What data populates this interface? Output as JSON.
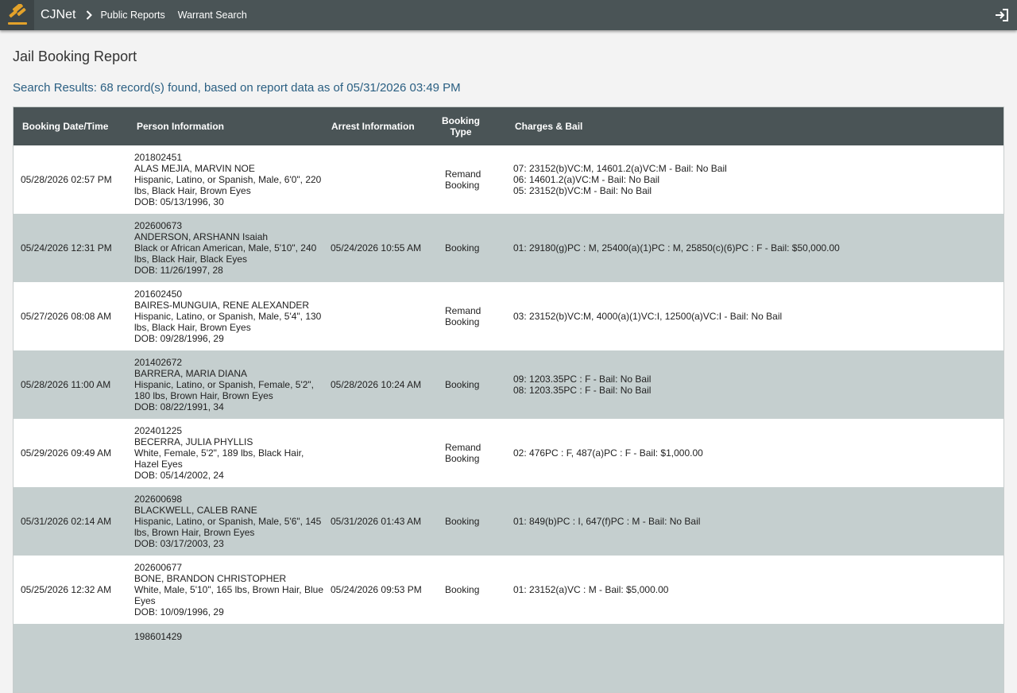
{
  "header": {
    "brand": "CJNet",
    "nav": [
      "Public Reports",
      "Warrant Search"
    ]
  },
  "page": {
    "title": "Jail Booking Report",
    "results": "Search Results: 68 record(s) found, based on report data as of 05/31/2026 03:49 PM"
  },
  "table": {
    "columns": [
      "Booking Date/Time",
      "Person Information",
      "Arrest Information",
      "Booking Type",
      "Charges & Bail"
    ],
    "rows": [
      {
        "booking": "05/28/2026 02:57 PM",
        "person": [
          "201802451",
          "ALAS MEJIA, MARVIN NOE",
          "Hispanic, Latino, or Spanish, Male, 6'0\", 220 lbs, Black Hair, Brown Eyes",
          "DOB: 05/13/1996, 30"
        ],
        "arrest": "",
        "type": [
          "Remand",
          "Booking"
        ],
        "charges": [
          "07: 23152(b)VC:M, 14601.2(a)VC:M - Bail: No Bail",
          "06: 14601.2(a)VC:M - Bail: No Bail",
          "05: 23152(b)VC:M - Bail: No Bail"
        ]
      },
      {
        "booking": "05/24/2026 12:31 PM",
        "person": [
          "202600673",
          "ANDERSON, ARSHANN Isaiah",
          "Black or African American, Male, 5'10\", 240 lbs, Black Hair, Black Eyes",
          "DOB: 11/26/1997, 28"
        ],
        "arrest": "05/24/2026 10:55 AM",
        "type": [
          "Booking"
        ],
        "charges": [
          "01: 29180(g)PC : M, 25400(a)(1)PC : M, 25850(c)(6)PC : F - Bail: $50,000.00"
        ]
      },
      {
        "booking": "05/27/2026 08:08 AM",
        "person": [
          "201602450",
          "BAIRES-MUNGUIA, RENE ALEXANDER",
          "Hispanic, Latino, or Spanish, Male, 5'4\", 130 lbs, Black Hair, Brown Eyes",
          "DOB: 09/28/1996, 29"
        ],
        "arrest": "",
        "type": [
          "Remand",
          "Booking"
        ],
        "charges": [
          "03: 23152(b)VC:M, 4000(a)(1)VC:I, 12500(a)VC:I - Bail: No Bail"
        ]
      },
      {
        "booking": "05/28/2026 11:00 AM",
        "person": [
          "201402672",
          "BARRERA, MARIA DIANA",
          "Hispanic, Latino, or Spanish, Female, 5'2\", 180 lbs, Brown Hair, Brown Eyes",
          "DOB: 08/22/1991, 34"
        ],
        "arrest": "05/28/2026 10:24 AM",
        "type": [
          "Booking"
        ],
        "charges": [
          "09: 1203.35PC : F - Bail: No Bail",
          "08: 1203.35PC : F - Bail: No Bail"
        ]
      },
      {
        "booking": "05/29/2026 09:49 AM",
        "person": [
          "202401225",
          "BECERRA, JULIA PHYLLIS",
          "White, Female, 5'2\", 189 lbs, Black Hair, Hazel Eyes",
          "DOB: 05/14/2002, 24"
        ],
        "arrest": "",
        "type": [
          "Remand",
          "Booking"
        ],
        "charges": [
          "02: 476PC : F, 487(a)PC : F - Bail: $1,000.00"
        ]
      },
      {
        "booking": "05/31/2026 02:14 AM",
        "person": [
          "202600698",
          "BLACKWELL, CALEB RANE",
          "Hispanic, Latino, or Spanish, Male, 5'6\", 145 lbs, Brown Hair, Brown Eyes",
          "DOB: 03/17/2003, 23"
        ],
        "arrest": "05/31/2026 01:43 AM",
        "type": [
          "Booking"
        ],
        "charges": [
          "01: 849(b)PC : I, 647(f)PC : M - Bail: No Bail"
        ]
      },
      {
        "booking": "05/25/2026 12:32 AM",
        "person": [
          "202600677",
          "BONE, BRANDON CHRISTOPHER",
          "White, Male, 5'10\", 165 lbs, Brown Hair, Blue Eyes",
          "DOB: 10/09/1996, 29"
        ],
        "arrest": "05/24/2026 09:53 PM",
        "type": [
          "Booking"
        ],
        "charges": [
          "01: 23152(a)VC : M - Bail: $5,000.00"
        ]
      },
      {
        "booking": "",
        "person": [
          "198601429",
          "",
          "",
          ""
        ],
        "arrest": "",
        "type": [],
        "charges": []
      }
    ]
  }
}
